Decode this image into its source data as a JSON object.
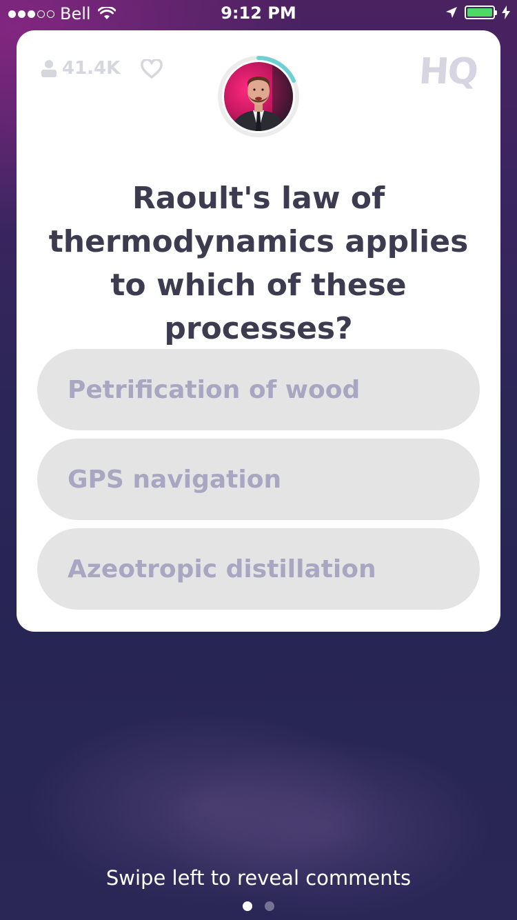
{
  "status_bar": {
    "carrier": "Bell",
    "time": "9:12 PM",
    "signal_bars_filled": 3,
    "signal_bars_total": 5,
    "battery_color": "#4cd964"
  },
  "card": {
    "viewer_count": "41.4K",
    "logo_text": "HQ",
    "timer_color": "#6fd0d3",
    "question": "Raoult's law of thermodynamics applies to which of these processes?",
    "answers": [
      {
        "label": "Petrification of wood"
      },
      {
        "label": "GPS navigation"
      },
      {
        "label": "Azeotropic distillation"
      }
    ]
  },
  "footer": {
    "hint": "Swipe left to reveal comments",
    "page_count": 2,
    "active_page": 1
  },
  "colors": {
    "question_text": "#3c3b4f",
    "answer_bg": "#e4e4e4",
    "answer_text": "#a9a6c2",
    "card_bg": "#ffffff"
  },
  "icons": [
    "signal-dots-icon",
    "wifi-icon",
    "location-arrow-icon",
    "battery-icon",
    "charging-bolt-icon",
    "person-icon",
    "heart-icon"
  ]
}
